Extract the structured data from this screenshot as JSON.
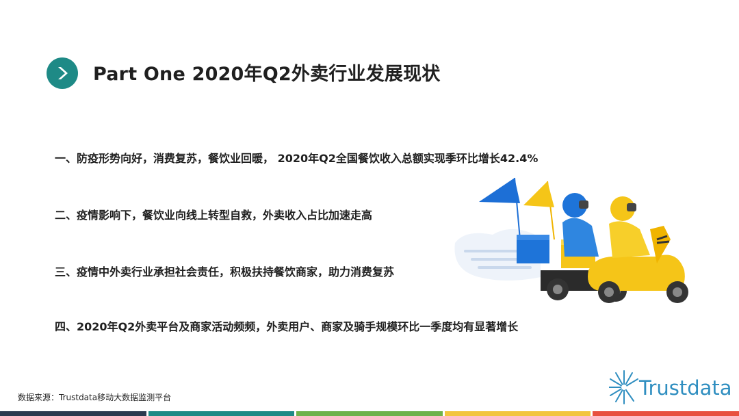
{
  "header": {
    "title": "Part One 2020年Q2外卖行业发展现状"
  },
  "points": [
    {
      "num": "一、",
      "text": "防疫形势向好，消费复苏，餐饮业回暖，  2020年Q2全国餐饮收入总额实现季环比增长42.4%"
    },
    {
      "num": "二、",
      "text": "疫情影响下，餐饮业向线上转型自救，外卖收入占比加速走高"
    },
    {
      "num": "三、",
      "text": "疫情中外卖行业承担社会责任，积极扶持餐饮商家，助力消费复苏"
    },
    {
      "num": "四、",
      "text": "2020年Q2外卖平台及商家活动频频，外卖用户、商家及骑手规模环比一季度均有显著增长"
    }
  ],
  "source": "数据来源：Trustdata移动大数据监测平台",
  "logo": {
    "text": "Trustdata",
    "icon": "sunburst-logo-icon"
  },
  "colors": {
    "accent": "#1e8a86",
    "logo": "#2f8ec0",
    "footer": [
      "#2b3a4f",
      "#1e8a86",
      "#6fb24a",
      "#f2c53d",
      "#e8503f"
    ]
  }
}
